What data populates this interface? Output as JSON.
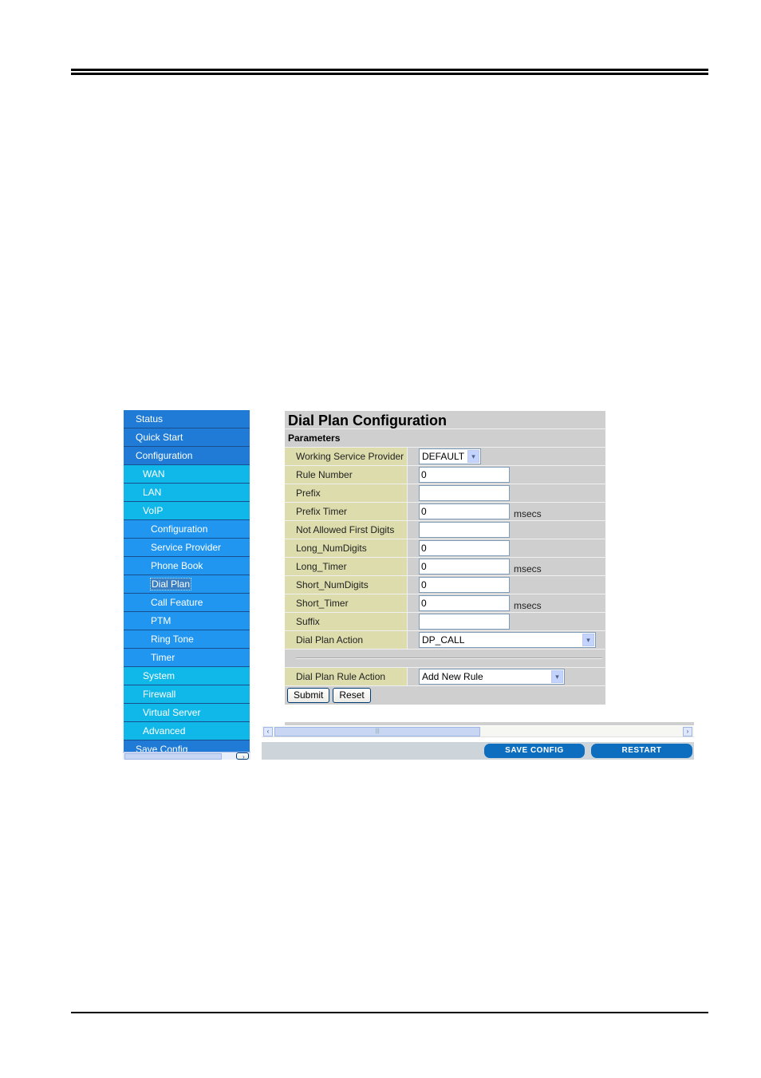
{
  "sidebar": {
    "items": [
      {
        "label": "Status",
        "level": 0
      },
      {
        "label": "Quick Start",
        "level": 0
      },
      {
        "label": "Configuration",
        "level": 0
      },
      {
        "label": "WAN",
        "level": 1
      },
      {
        "label": "LAN",
        "level": 1
      },
      {
        "label": "VoIP",
        "level": 1
      },
      {
        "label": "Configuration",
        "level": 2
      },
      {
        "label": "Service Provider",
        "level": 2
      },
      {
        "label": "Phone Book",
        "level": 2
      },
      {
        "label": "Dial Plan",
        "level": 2,
        "selected": true
      },
      {
        "label": "Call Feature",
        "level": 2
      },
      {
        "label": "PTM",
        "level": 2
      },
      {
        "label": "Ring Tone",
        "level": 2
      },
      {
        "label": "Timer",
        "level": 2
      },
      {
        "label": "System",
        "level": 1
      },
      {
        "label": "Firewall",
        "level": 1
      },
      {
        "label": "Virtual Server",
        "level": 1
      },
      {
        "label": "Advanced",
        "level": 1
      },
      {
        "label": "Save Config",
        "level": 0
      }
    ],
    "scroll_down_icon": "▾",
    "grip": "≡"
  },
  "form": {
    "title": "Dial Plan Configuration",
    "section": "Parameters",
    "working_service_provider": {
      "label": "Working Service Provider",
      "value": "DEFAULT"
    },
    "rule_number": {
      "label": "Rule Number",
      "value": "0"
    },
    "prefix": {
      "label": "Prefix",
      "value": ""
    },
    "prefix_timer": {
      "label": "Prefix Timer",
      "value": "0",
      "unit": "msecs"
    },
    "not_allowed_first_digits": {
      "label": "Not Allowed First Digits",
      "value": ""
    },
    "long_numdigits": {
      "label": "Long_NumDigits",
      "value": "0"
    },
    "long_timer": {
      "label": "Long_Timer",
      "value": "0",
      "unit": "msecs"
    },
    "short_numdigits": {
      "label": "Short_NumDigits",
      "value": "0"
    },
    "short_timer": {
      "label": "Short_Timer",
      "value": "0",
      "unit": "msecs"
    },
    "suffix": {
      "label": "Suffix",
      "value": ""
    },
    "dial_plan_action": {
      "label": "Dial Plan Action",
      "value": "DP_CALL"
    },
    "dial_plan_rule_action": {
      "label": "Dial Plan Rule Action",
      "value": "Add New Rule"
    },
    "submit_label": "Submit",
    "reset_label": "Reset"
  },
  "footer": {
    "save_config_label": "SAVE CONFIG",
    "restart_label": "RESTART"
  },
  "icons": {
    "chevron_down": "▾",
    "arrow_left": "‹",
    "arrow_right": "›",
    "grip": "|||"
  }
}
